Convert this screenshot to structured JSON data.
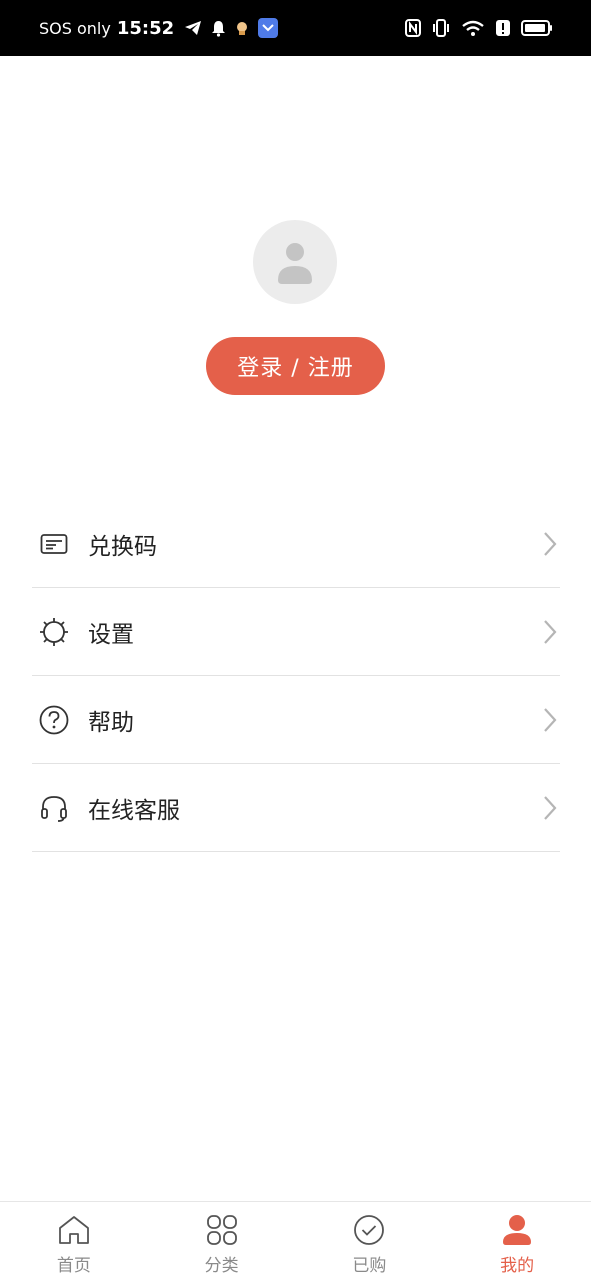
{
  "status_bar": {
    "carrier": "SOS only",
    "time": "15:52",
    "icons": [
      "telegram-icon",
      "bell-icon",
      "emoji-icon",
      "app-icon",
      "nfc-icon",
      "vibrate-icon",
      "wifi-icon",
      "alert-icon",
      "battery-icon"
    ]
  },
  "profile": {
    "login_label": "登录 / 注册"
  },
  "menu": {
    "items": [
      {
        "label": "兑换码",
        "icon": "redeem-card-icon"
      },
      {
        "label": "设置",
        "icon": "settings-icon"
      },
      {
        "label": "帮助",
        "icon": "help-icon"
      },
      {
        "label": "在线客服",
        "icon": "headset-icon"
      }
    ]
  },
  "tab_bar": {
    "tabs": [
      {
        "label": "首页",
        "icon": "home-icon"
      },
      {
        "label": "分类",
        "icon": "category-icon"
      },
      {
        "label": "已购",
        "icon": "purchased-icon"
      },
      {
        "label": "我的",
        "icon": "profile-icon"
      }
    ],
    "active_index": 3
  },
  "colors": {
    "accent": "#e4604a",
    "text": "#222222",
    "muted": "#8a8a8a",
    "divider": "#e2e2e2"
  }
}
